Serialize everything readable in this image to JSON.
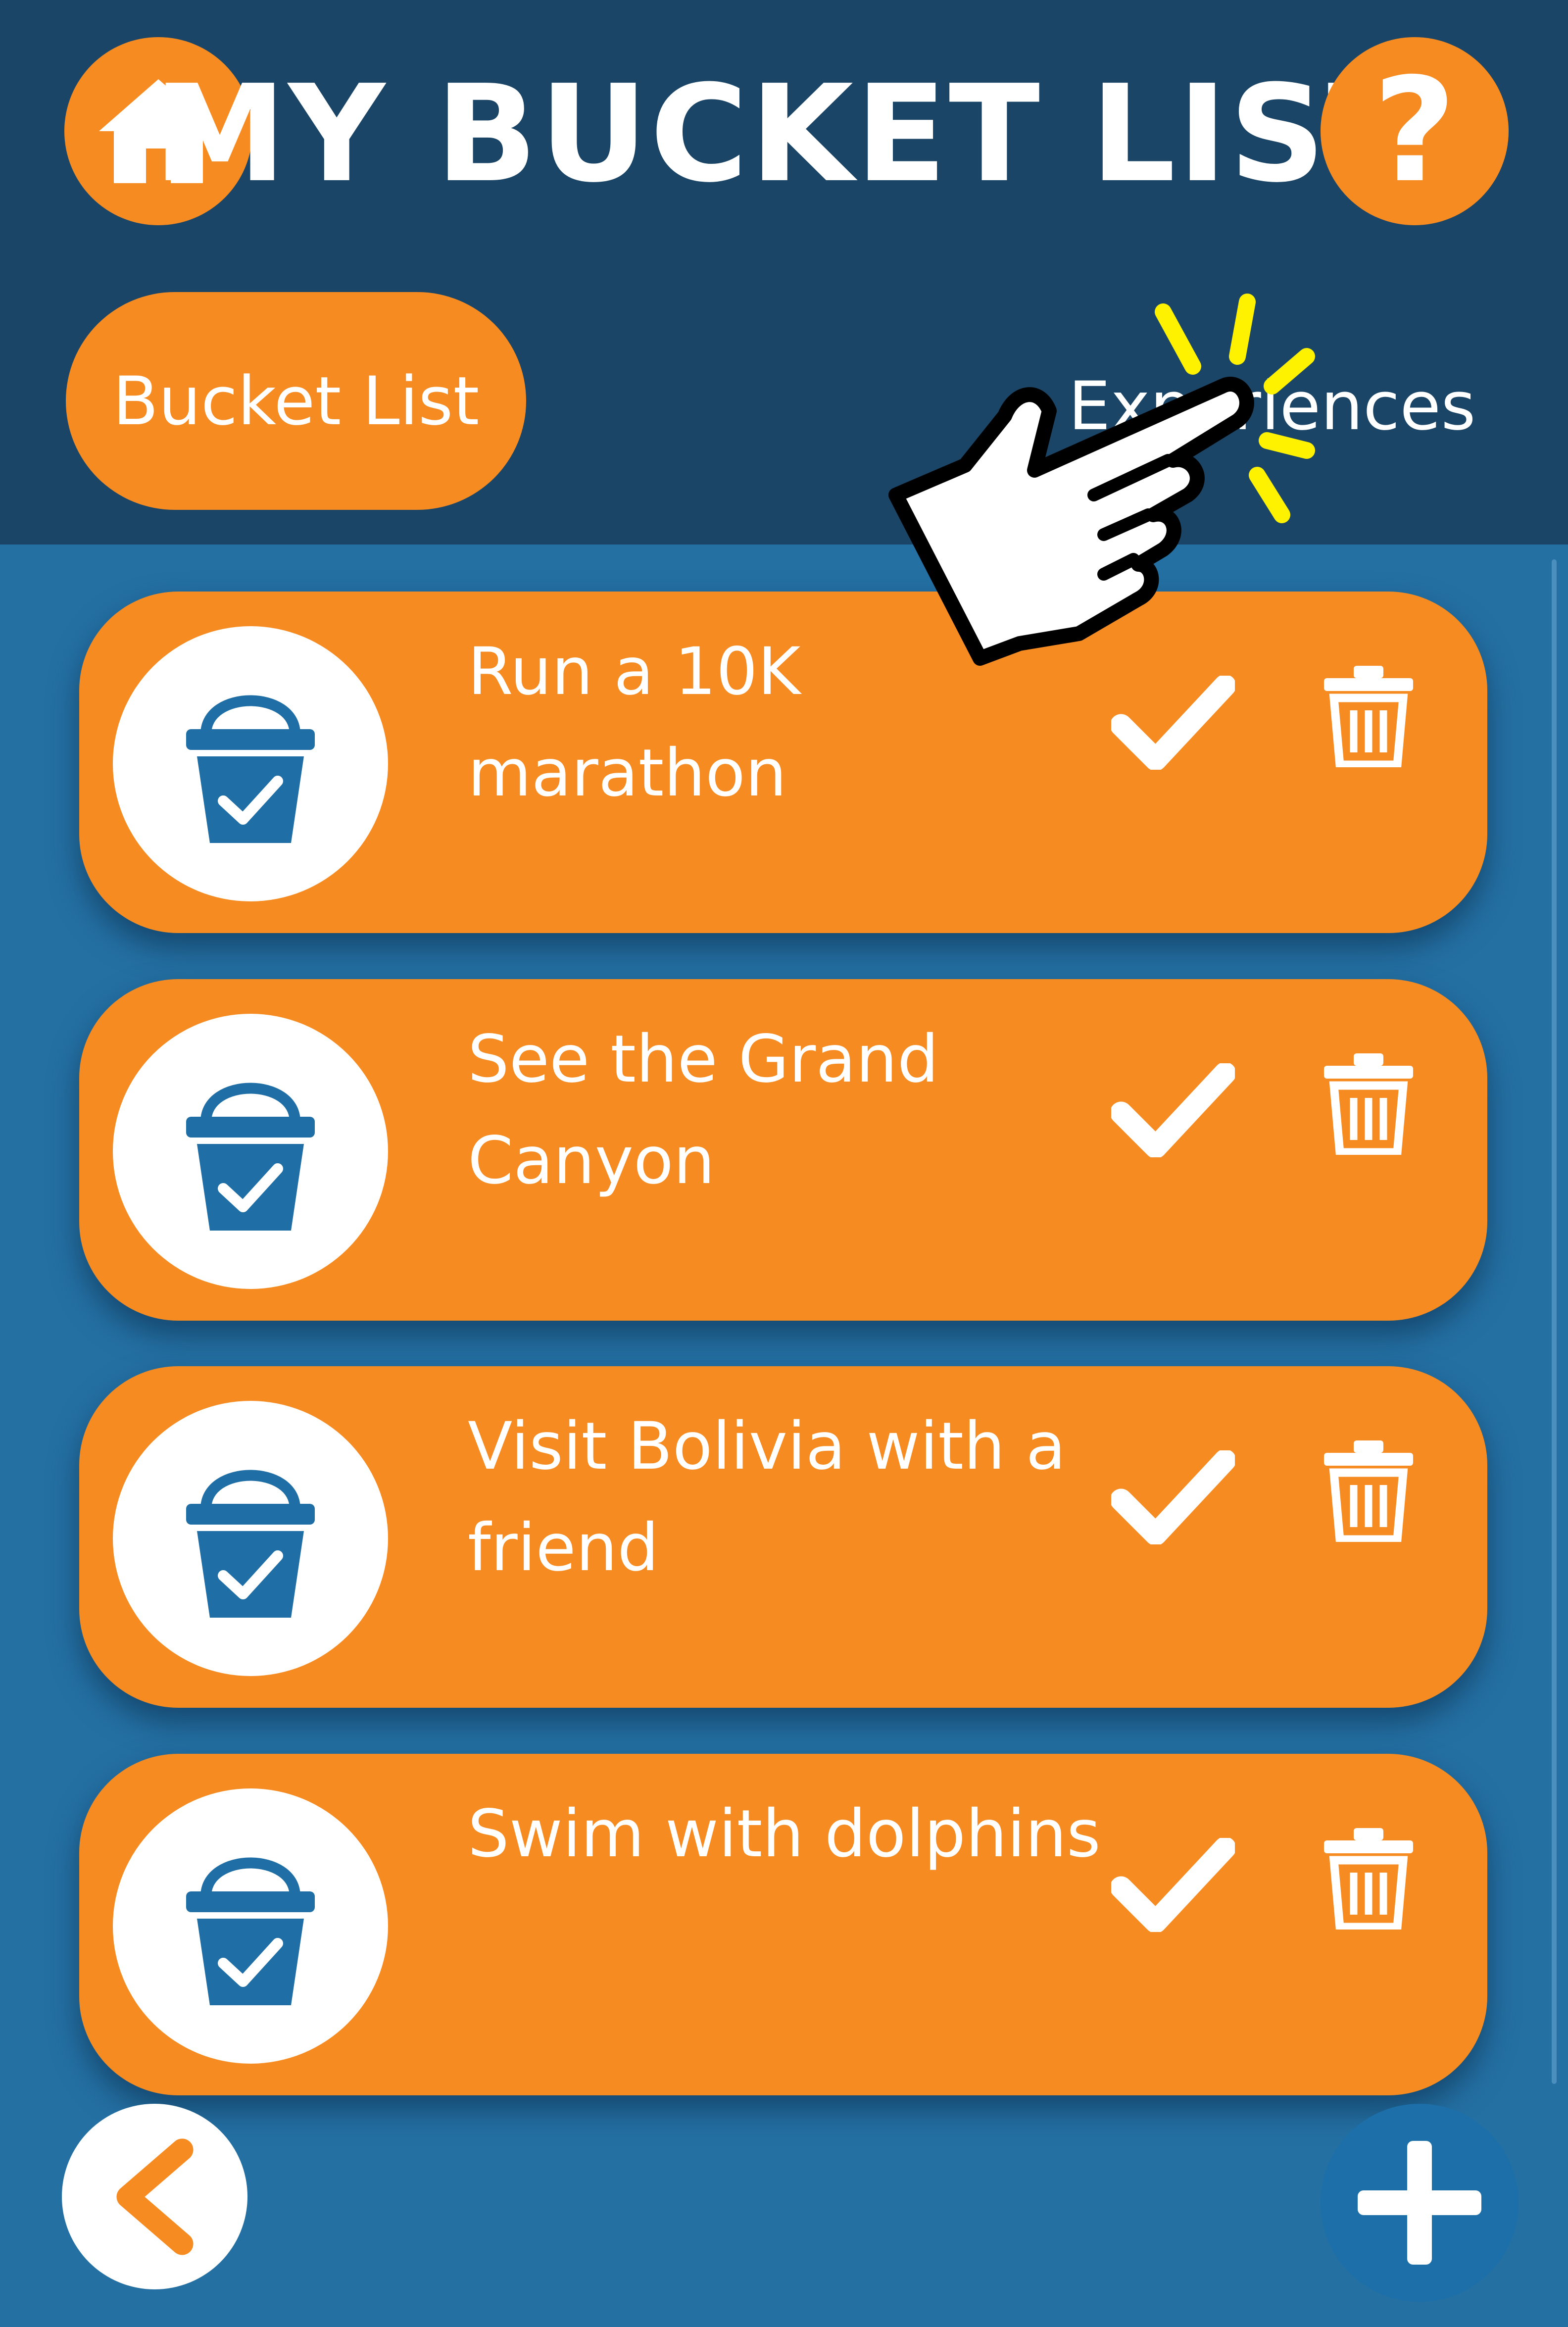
{
  "app": {
    "title": "MY BUCKET LIST",
    "help_label": "?"
  },
  "tabs": [
    {
      "label": "Bucket List",
      "active": true
    },
    {
      "label": "Experiences",
      "active": false
    }
  ],
  "bucket_items": [
    {
      "text": "Run a 10K marathon"
    },
    {
      "text": "See the Grand Canyon"
    },
    {
      "text": "Visit Bolivia with a friend"
    },
    {
      "text": "Swim with dolphins"
    }
  ],
  "icons": {
    "home": "home-icon",
    "help": "question-mark-icon",
    "item_avatar": "bucket-check-icon",
    "complete": "checkmark-icon",
    "delete": "trash-icon",
    "back": "chevron-left-icon",
    "add": "plus-icon",
    "pointer": "hand-pointer-icon"
  },
  "colors": {
    "header_bg": "#1a4566",
    "body_bg": "#2470a3",
    "accent_orange": "#f68c21",
    "icon_blue": "#1f6fa6",
    "text_white": "#ffffff",
    "tap_highlight": "#fff200"
  }
}
